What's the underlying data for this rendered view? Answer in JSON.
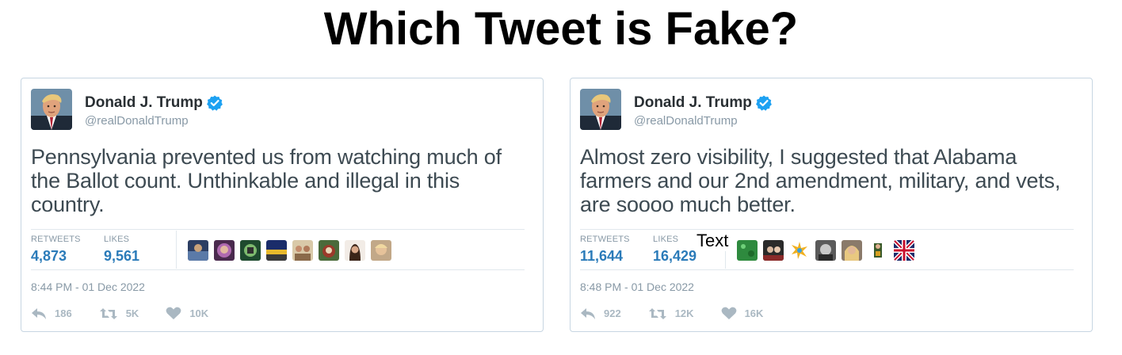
{
  "page": {
    "title": "Which Tweet is Fake?"
  },
  "colors": {
    "verified": "#1da1f2",
    "stat_value": "#2b7bb9",
    "muted": "#8899a6",
    "border": "#c7d6e2"
  },
  "tweets": [
    {
      "display_name": "Donald J. Trump",
      "handle": "@realDonaldTrump",
      "verified_icon": "verified-badge-icon",
      "text": "Pennsylvania prevented us from watching much of the Ballot count. Unthinkable and illegal in this country.",
      "retweets_label": "RETWEETS",
      "retweets_count": "4,873",
      "likes_label": "LIKES",
      "likes_count": "9,561",
      "timestamp": "8:44 PM - 01 Dec 2022",
      "reply_count": "186",
      "retweet_action_count": "5K",
      "like_action_count": "10K"
    },
    {
      "display_name": "Donald J. Trump",
      "handle": "@realDonaldTrump",
      "verified_icon": "verified-badge-icon",
      "text": "Almost zero visibility, I suggested that Alabama farmers and our 2nd amendment, military, and vets, are soooo much better.",
      "retweets_label": "RETWEETS",
      "retweets_count": "11,644",
      "likes_label": "LIKES",
      "likes_count": "16,429",
      "overlay_text": "Text",
      "timestamp": "8:48 PM - 01 Dec 2022",
      "reply_count": "922",
      "retweet_action_count": "12K",
      "like_action_count": "16K"
    }
  ]
}
